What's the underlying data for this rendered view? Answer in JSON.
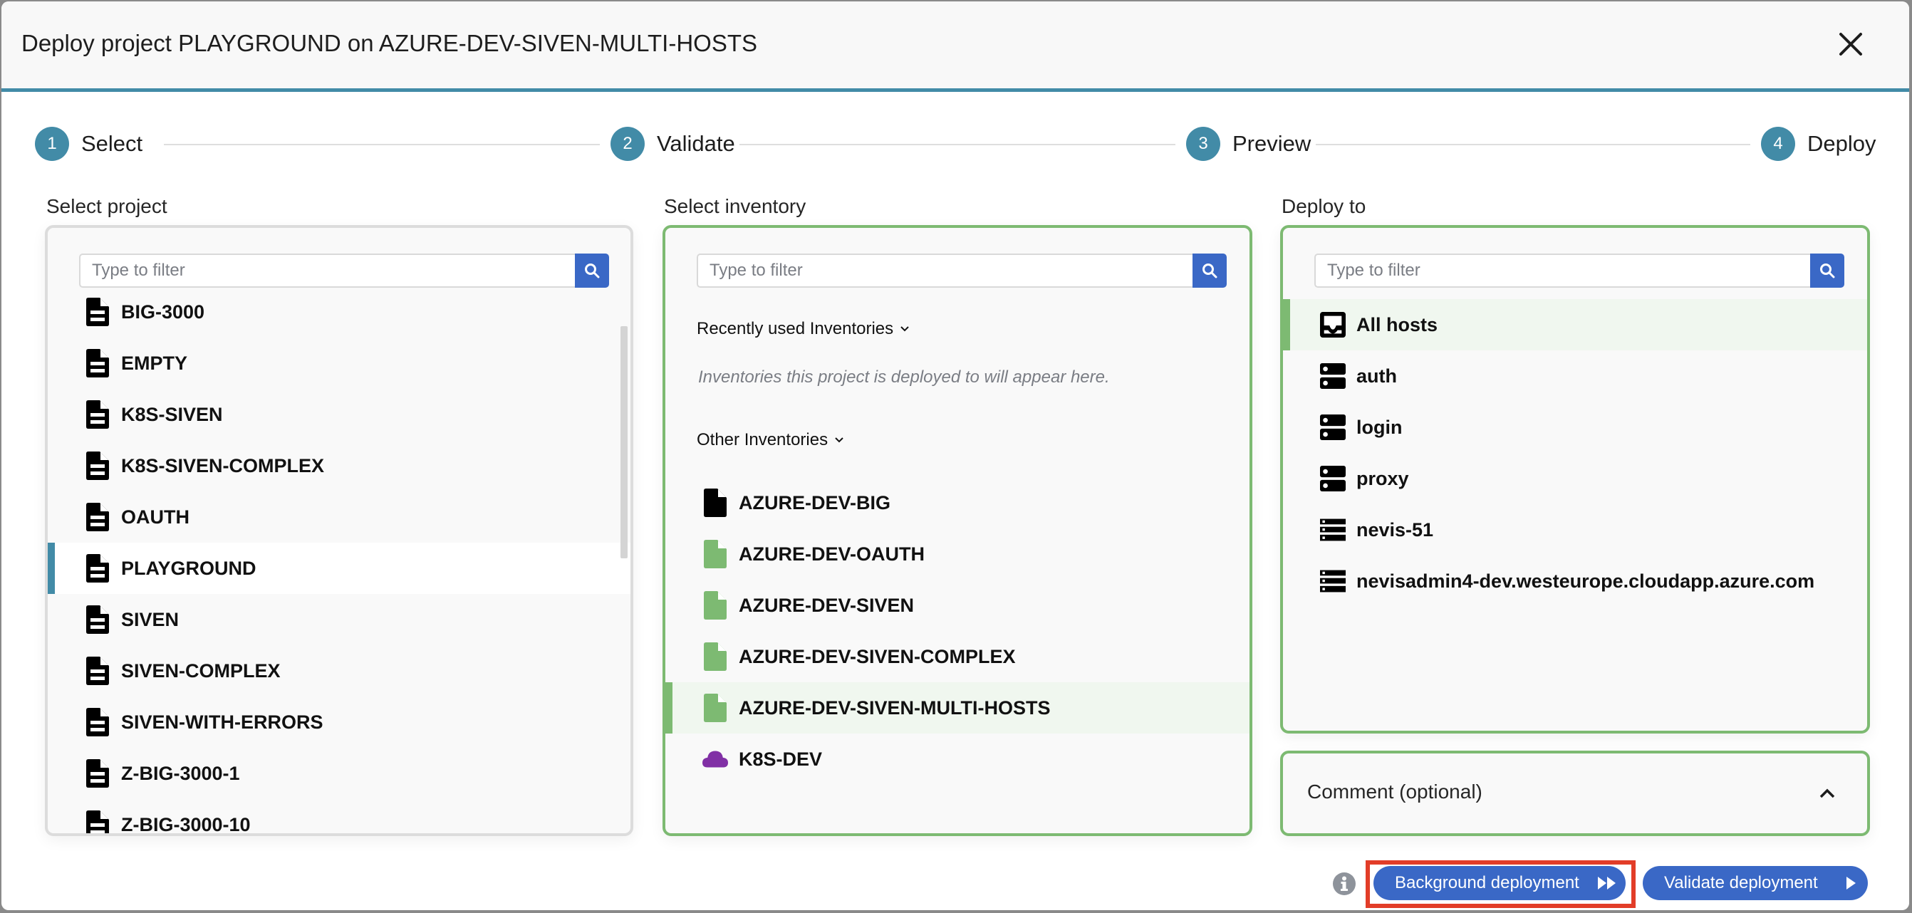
{
  "dialog": {
    "title": "Deploy project PLAYGROUND on AZURE-DEV-SIVEN-MULTI-HOSTS",
    "close_icon": "close-icon"
  },
  "stepper": {
    "steps": [
      {
        "number": "1",
        "label": "Select"
      },
      {
        "number": "2",
        "label": "Validate"
      },
      {
        "number": "3",
        "label": "Preview"
      },
      {
        "number": "4",
        "label": "Deploy"
      }
    ],
    "active_step": 1
  },
  "project_panel": {
    "label": "Select project",
    "filter_placeholder": "Type to filter",
    "selected": "PLAYGROUND",
    "items": [
      {
        "name": "BIG-3000",
        "icon": "project-file-icon"
      },
      {
        "name": "EMPTY",
        "icon": "project-file-icon"
      },
      {
        "name": "K8S-SIVEN",
        "icon": "project-file-icon"
      },
      {
        "name": "K8S-SIVEN-COMPLEX",
        "icon": "project-file-icon"
      },
      {
        "name": "OAUTH",
        "icon": "project-file-icon"
      },
      {
        "name": "PLAYGROUND",
        "icon": "project-file-icon"
      },
      {
        "name": "SIVEN",
        "icon": "project-file-icon"
      },
      {
        "name": "SIVEN-COMPLEX",
        "icon": "project-file-icon"
      },
      {
        "name": "SIVEN-WITH-ERRORS",
        "icon": "project-file-icon"
      },
      {
        "name": "Z-BIG-3000-1",
        "icon": "project-file-icon"
      },
      {
        "name": "Z-BIG-3000-10",
        "icon": "project-file-icon"
      }
    ]
  },
  "inventory_panel": {
    "label": "Select inventory",
    "filter_placeholder": "Type to filter",
    "recent_heading": "Recently used Inventories",
    "recent_empty_hint": "Inventories this project is deployed to will appear here.",
    "other_heading": "Other Inventories",
    "selected": "AZURE-DEV-SIVEN-MULTI-HOSTS",
    "items": [
      {
        "name": "AZURE-DEV-BIG",
        "icon": "file-icon",
        "color": "#000000"
      },
      {
        "name": "AZURE-DEV-OAUTH",
        "icon": "file-icon",
        "color": "#7dba72"
      },
      {
        "name": "AZURE-DEV-SIVEN",
        "icon": "file-icon",
        "color": "#7dba72"
      },
      {
        "name": "AZURE-DEV-SIVEN-COMPLEX",
        "icon": "file-icon",
        "color": "#7dba72"
      },
      {
        "name": "AZURE-DEV-SIVEN-MULTI-HOSTS",
        "icon": "file-icon",
        "color": "#7dba72"
      },
      {
        "name": "K8S-DEV",
        "icon": "cloud-icon",
        "color": "#8130a5"
      }
    ]
  },
  "deploy_panel": {
    "label": "Deploy to",
    "filter_placeholder": "Type to filter",
    "selected": "All hosts",
    "items": [
      {
        "name": "All hosts",
        "icon": "inbox-icon"
      },
      {
        "name": "auth",
        "icon": "server-group-icon"
      },
      {
        "name": "login",
        "icon": "server-group-icon"
      },
      {
        "name": "proxy",
        "icon": "server-group-icon"
      },
      {
        "name": "nevis-51",
        "icon": "server-icon"
      },
      {
        "name": "nevisadmin4-dev.westeurope.cloudapp.azure.com",
        "icon": "server-icon"
      }
    ]
  },
  "comment_panel": {
    "label": "Comment (optional)",
    "expanded": false
  },
  "footer": {
    "info_icon": "info-icon",
    "background_deploy_label": "Background deployment",
    "validate_deploy_label": "Validate deployment"
  },
  "colors": {
    "accent_teal": "#428ba7",
    "primary_blue": "#3a68c6",
    "success_green": "#7dba72",
    "k8s_purple": "#8130a5",
    "highlight_red": "#e23d28"
  }
}
